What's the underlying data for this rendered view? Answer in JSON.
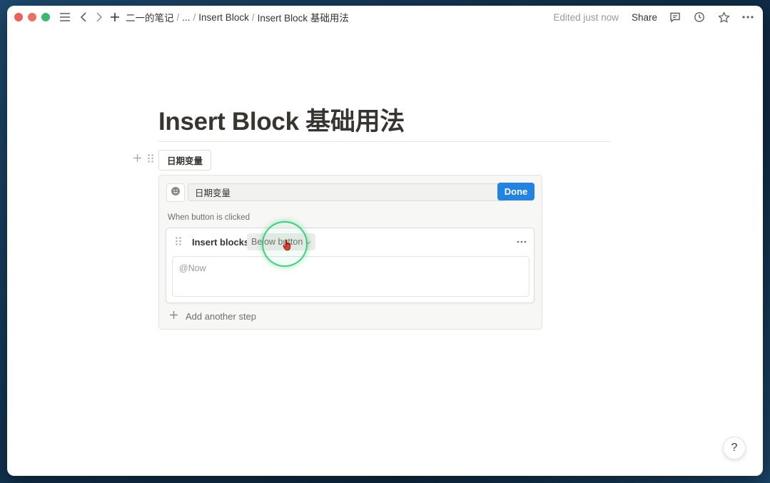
{
  "topbar": {
    "breadcrumbs": [
      "二一的笔记",
      "...",
      "Insert Block",
      "Insert Block 基础用法"
    ],
    "edited": "Edited just now",
    "share": "Share"
  },
  "page": {
    "title": "Insert Block 基础用法"
  },
  "button_block": {
    "label": "日期变量"
  },
  "editor": {
    "name_value": "日期变量",
    "done": "Done",
    "when_label": "When button is clicked",
    "step": {
      "title": "Insert blocks",
      "position": "Below button",
      "content": "@Now"
    },
    "add_step": "Add another step"
  },
  "help": "?",
  "colors": {
    "accent": "#2383e2",
    "cursor_ring": "#22c86e"
  },
  "icons": [
    "menu-icon",
    "back-icon",
    "forward-icon",
    "new-page-icon",
    "comment-icon",
    "history-icon",
    "star-icon",
    "more-icon",
    "emoji-icon",
    "drag-handle-icon",
    "plus-icon",
    "hand-cursor-icon"
  ]
}
